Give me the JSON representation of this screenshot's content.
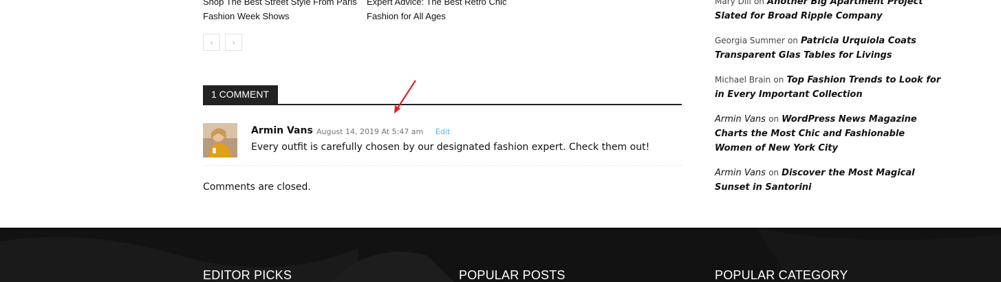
{
  "related_posts": [
    {
      "title": "Shop The Best Street Style From Paris Fashion Week Shows"
    },
    {
      "title": "Expert Advice: The Best Retro Chic Fashion for All Ages"
    }
  ],
  "pager": {
    "prev_icon": "‹",
    "next_icon": "›"
  },
  "comments": {
    "heading": "1 COMMENT",
    "items": [
      {
        "author": "Armin Vans",
        "date": "August 14, 2019 At 5:47 am",
        "edit_label": "Edit",
        "text": "Every outfit is carefully chosen by our designated fashion expert. Check them out!"
      }
    ],
    "closed_text": "Comments are closed."
  },
  "sidebar": {
    "recent_comments": [
      {
        "author": "Mary Dill",
        "on": "on",
        "title": "Another Big Apartment Project Slated for Broad Ripple Company",
        "author_style": "plain"
      },
      {
        "author": "Georgia Summer",
        "on": "on",
        "title": "Patricia Urquiola Coats Transparent Glas Tables for Livings",
        "author_style": "plain"
      },
      {
        "author": "Michael Brain",
        "on": "on",
        "title": "Top Fashion Trends to Look for in Every Important Collection",
        "author_style": "plain"
      },
      {
        "author": "Armin Vans",
        "on": "on",
        "title": "WordPress News Magazine Charts the Most Chic and Fashionable Women of New York City",
        "author_style": "italic"
      },
      {
        "author": "Armin Vans",
        "on": "on",
        "title": "Discover the Most Magical Sunset in Santorini",
        "author_style": "italic"
      }
    ]
  },
  "footer": {
    "headings": [
      "EDITOR PICKS",
      "POPULAR POSTS",
      "POPULAR CATEGORY"
    ]
  },
  "colors": {
    "accent": "#4db2ec",
    "footer_bg": "#121212",
    "annotation_arrow": "#e02020"
  }
}
